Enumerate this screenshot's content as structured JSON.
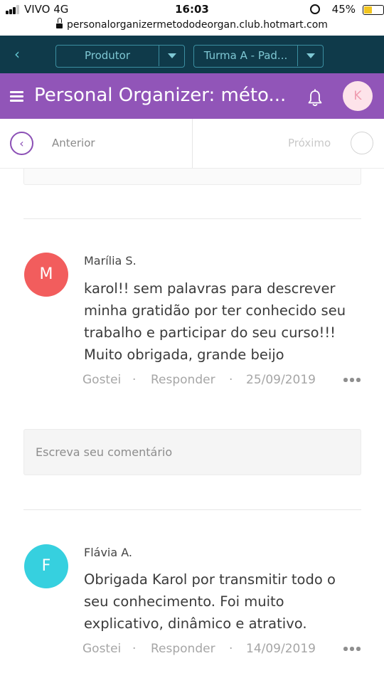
{
  "status_bar": {
    "carrier": "VIVO 4G",
    "time": "16:03",
    "battery_pct": "45%",
    "battery_level": 0.45,
    "url": "personalorganizermetododeorgan.club.hotmart.com"
  },
  "topbar": {
    "select_produtor": "Produtor",
    "select_turma": "Turma A - Pad..."
  },
  "header": {
    "title": "Personal Organizer: méto...",
    "avatar_initial": "K"
  },
  "nav": {
    "prev_label": "Anterior",
    "next_label": "Próximo"
  },
  "comments": [
    {
      "avatar_initial": "M",
      "avatar_color": "#f25d5d",
      "author": "Marília S.",
      "text": "karol!! sem palavras para descrever minha gratidão por ter conhecido seu trabalho e participar do seu curso!!! Muito obrigada, grande beijo",
      "like": "Gostei",
      "reply": "Responder",
      "date": "25/09/2019"
    },
    {
      "avatar_initial": "F",
      "avatar_color": "#36d0df",
      "author": "Flávia A.",
      "text": "Obrigada Karol por transmitir todo o seu conhecimento. Foi muito explicativo, dinâmico e atrativo.",
      "like": "Gostei",
      "reply": "Responder",
      "date": "14/09/2019"
    }
  ],
  "comment_box": {
    "placeholder": "Escreva seu comentário"
  },
  "separator": "·",
  "colors": {
    "topbar_bg": "#0f3a4a",
    "header_bg": "#9155b8",
    "accent_purple": "#8b4fb5",
    "select_border": "#3c8fa1"
  }
}
